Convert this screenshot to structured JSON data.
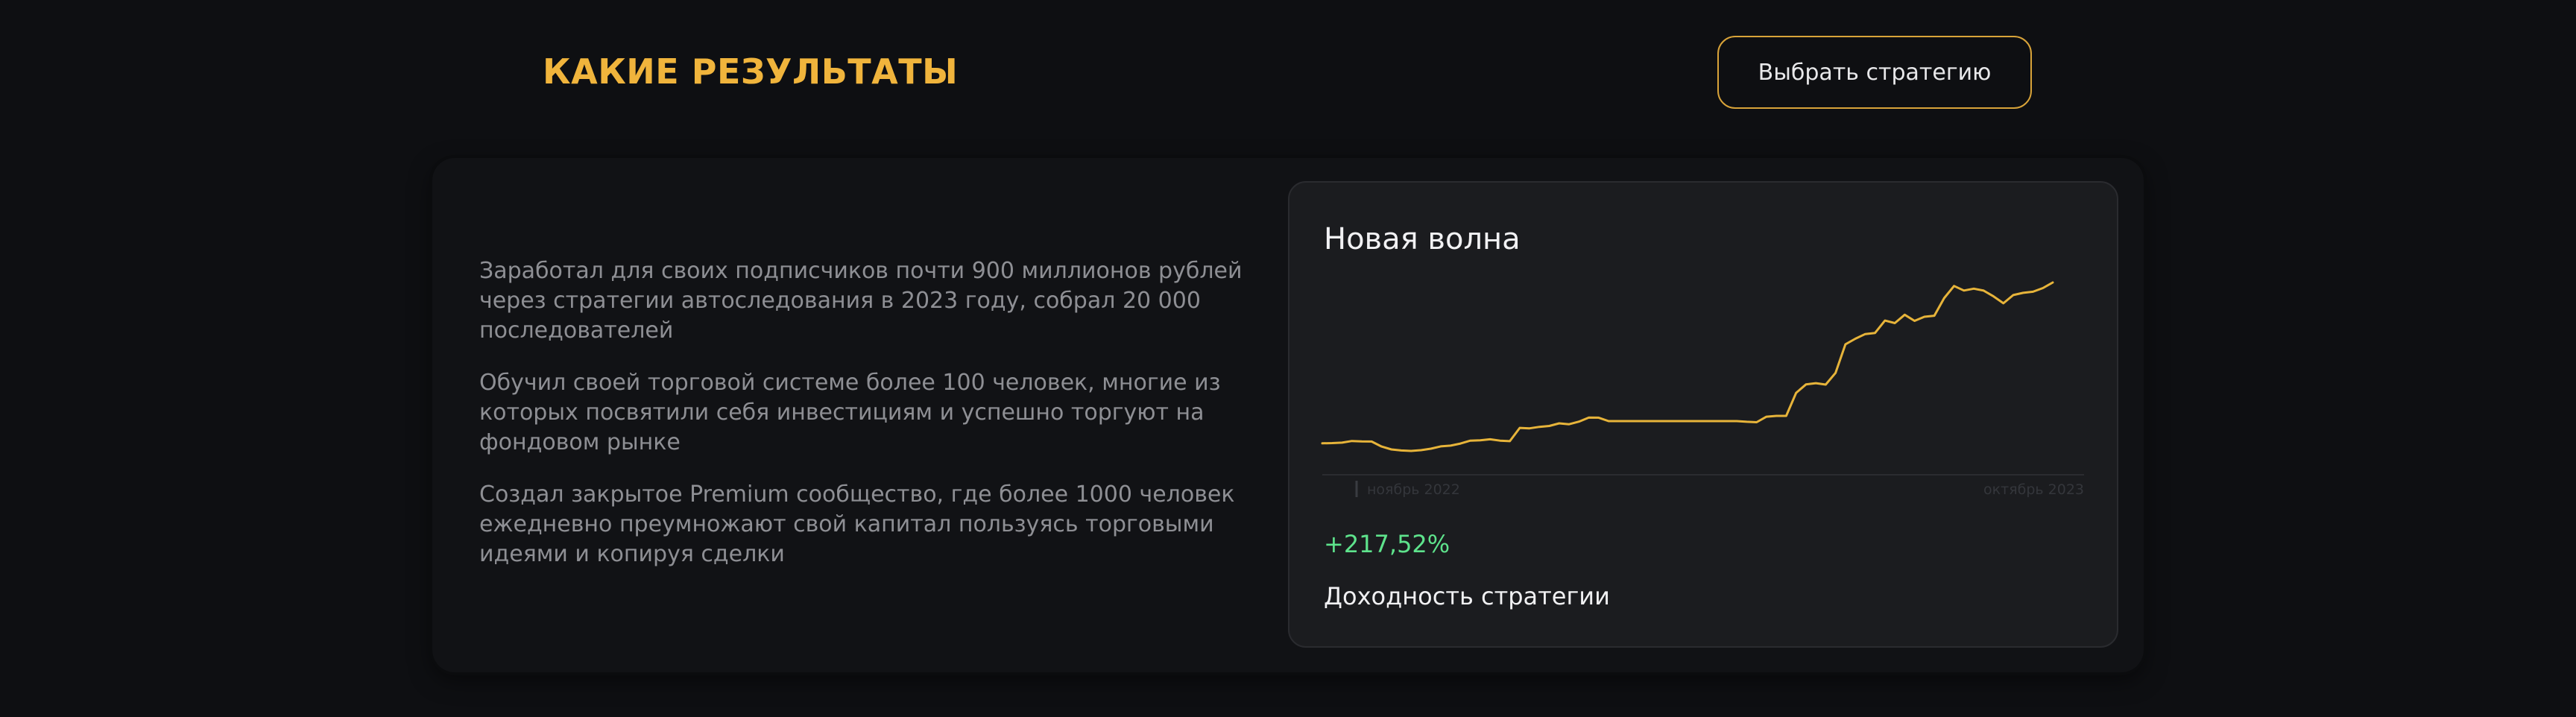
{
  "header": {
    "title": "КАКИЕ РЕЗУЛЬТАТЫ",
    "cta_label": "Выбрать стратегию"
  },
  "achievements": [
    "Заработал для своих подписчиков почти 900 миллионов рублей через стратегии автоследования в 2023 году, собрал 20 000 последователей",
    "Обучил своей торговой системе более 100 человек, многие из которых посвятили себя инвестициям и успешно торгуют на фондовом рынке",
    "Создал закрытое Premium сообщество, где более 1000 человек ежедневно преумножают свой капитал пользуясь торговыми идеями и копируя сделки"
  ],
  "strategy_card": {
    "name": "Новая волна",
    "yield_value": "+217,52%",
    "yield_caption": "Доходность стратегии",
    "axis_start_label": "ноябрь 2022",
    "axis_end_label": "октябрь 2023"
  },
  "colors": {
    "accent": "#f0b43c",
    "line": "#e7b43a",
    "positive": "#5ee38c",
    "background": "#0e0f12",
    "card": "#1b1c1f"
  },
  "chart_data": {
    "type": "line",
    "x_start": "ноябрь 2022",
    "x_end": "октябрь 2023",
    "series": [
      {
        "values": [
          -3.6,
          -3.4,
          -2.9,
          -1.0,
          -1.5,
          -1.6,
          -7.2,
          -10.4,
          -11.6,
          -12.1,
          -11.3,
          -9.6,
          -7.0,
          -6.2,
          -3.9,
          -0.6,
          -0.2,
          0.9,
          -0.6,
          -1.2,
          13.6,
          13.1,
          14.8,
          15.8,
          18.7,
          17.7,
          20.6,
          25.2,
          25.0,
          21.2,
          21.2,
          21.2,
          21.2,
          21.2,
          21.2,
          21.2,
          21.2,
          21.2,
          21.2,
          21.2,
          21.2,
          21.2,
          21.2,
          20.4,
          19.9,
          26.1,
          27.0,
          27.0,
          52.7,
          62.1,
          63.5,
          61.9,
          75.0,
          106.9,
          113.1,
          118.3,
          119.6,
          133.4,
          130.6,
          139.9,
          133.1,
          137.6,
          138.8,
          158.4,
          172.0,
          166.9,
          169.0,
          166.8,
          160.4,
          152.7,
          161.8,
          164.3,
          165.6,
          169.7,
          175.9
        ]
      }
    ]
  }
}
